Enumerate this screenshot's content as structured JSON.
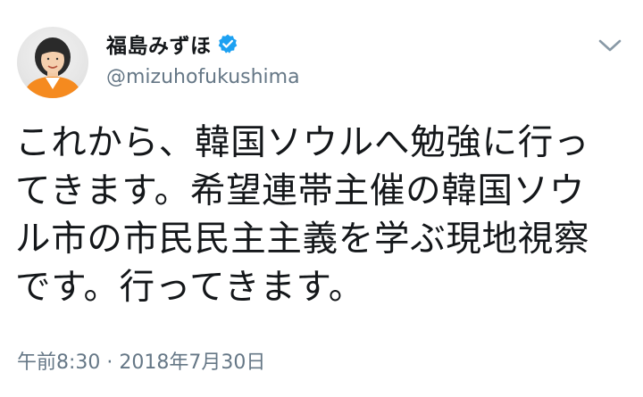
{
  "tweet": {
    "display_name": "福島みずほ",
    "handle": "@mizuhofukushima",
    "verified_icon": "verified-badge-icon",
    "menu_icon": "chevron-down-icon",
    "text": "これから、韓国ソウルへ勉強に行っ\nてきます。希望連帯主催の韓国ソウ\nル市の市民民主主義を学ぶ現地視察\nです。行ってきます。",
    "timestamp": "午前8:30 · 2018年7月30日"
  },
  "colors": {
    "accent": "#1da1f2",
    "text_primary": "#14171a",
    "text_secondary": "#657786",
    "avatar_shirt": "#f58a1f"
  }
}
